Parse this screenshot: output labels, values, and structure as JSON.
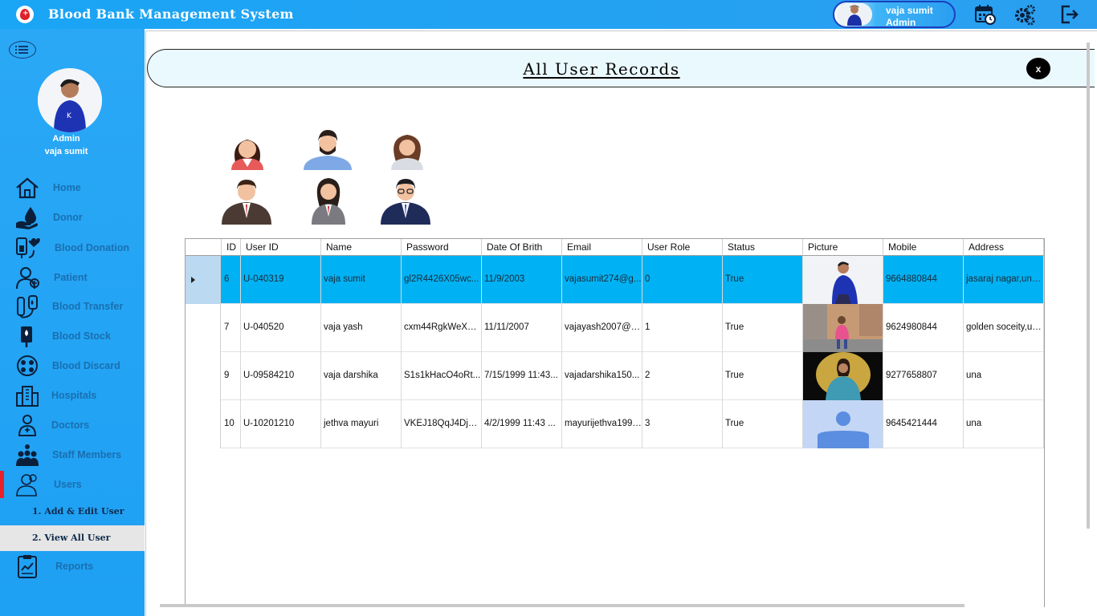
{
  "app": {
    "title": "Blood Bank Management System",
    "user_name": "vaja sumit",
    "user_role": "Admin"
  },
  "sidebar": {
    "profile_role": "Admin",
    "profile_name": "vaja sumit",
    "items": [
      {
        "label": "Home",
        "icon": "home-icon"
      },
      {
        "label": "Donor",
        "icon": "blood-drop-icon"
      },
      {
        "label": "Blood Donation",
        "icon": "blood-donation-icon"
      },
      {
        "label": "Patient",
        "icon": "patient-icon"
      },
      {
        "label": "Blood Transfer",
        "icon": "blood-transfer-icon"
      },
      {
        "label": "Blood Stock",
        "icon": "blood-stock-icon"
      },
      {
        "label": "Blood Discard",
        "icon": "blood-discard-icon"
      },
      {
        "label": "Hospitals",
        "icon": "hospital-icon"
      },
      {
        "label": "Doctors",
        "icon": "doctor-icon"
      },
      {
        "label": "Staff Members",
        "icon": "staff-icon"
      },
      {
        "label": "Users",
        "icon": "users-icon"
      },
      {
        "label": "Reports",
        "icon": "report-icon"
      }
    ],
    "sub_items": [
      {
        "label": "1.  Add & Edit User"
      },
      {
        "label": "2.  View All User"
      }
    ]
  },
  "main": {
    "page_title": "All User Records",
    "close_label": "x"
  },
  "grid": {
    "columns": [
      "ID",
      "User ID",
      "Name",
      "Password",
      "Date Of Brith",
      "Email",
      "User Role",
      "Status",
      "Picture",
      "Mobile",
      "Address"
    ],
    "rows": [
      {
        "id": "6",
        "user_id": "U-040319",
        "name": "vaja sumit",
        "password": "gl2R4426X05wc...",
        "dob": "11/9/2003",
        "email": "vajasumit274@g...",
        "role": "0",
        "status": "True",
        "mobile": "9664880844",
        "address": "jasaraj nagar,una..."
      },
      {
        "id": "7",
        "user_id": "U-040520",
        "name": "vaja yash",
        "password": "cxm44RgkWeXB...",
        "dob": "11/11/2007",
        "email": "vajayash2007@g...",
        "role": "1",
        "status": "True",
        "mobile": "9624980844",
        "address": "golden soceity,un..."
      },
      {
        "id": "9",
        "user_id": "U-09584210",
        "name": "vaja darshika",
        "password": "S1s1kHacO4oRt...",
        "dob": "7/15/1999 11:43...",
        "email": "vajadarshika150...",
        "role": "2",
        "status": "True",
        "mobile": "9277658807",
        "address": "una"
      },
      {
        "id": "10",
        "user_id": "U-10201210",
        "name": "jethva mayuri",
        "password": "VKEJ18QqJ4DjR...",
        "dob": "4/2/1999 11:43 ...",
        "email": "mayurijethva1999...",
        "role": "3",
        "status": "True",
        "mobile": "9645421444",
        "address": "una"
      }
    ]
  },
  "colors": {
    "accent": "#1ea0f3",
    "selected_row": "#00b2f3",
    "active_marker": "#e8202a"
  }
}
